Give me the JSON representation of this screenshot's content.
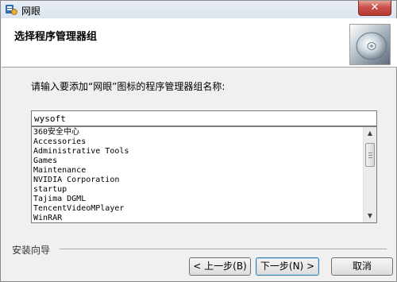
{
  "window": {
    "title": "网眼",
    "close_glyph": "✕"
  },
  "header": {
    "title": "选择程序管理器组",
    "image_icon": "cd-disc-icon"
  },
  "body": {
    "prompt": "请输入要添加“网眼”图标的程序管理器组名称:",
    "group_input_value": "wysoft",
    "groups": [
      "360安全中心",
      "Accessories",
      "Administrative Tools",
      "Games",
      "Maintenance",
      "NVIDIA Corporation",
      "startup",
      "Tajima DGML",
      "TencentVideoMPlayer",
      "WinRAR"
    ]
  },
  "footer": {
    "branding": "安装向导",
    "back_label": "< 上一步(B)",
    "next_label": "下一步(N) >",
    "cancel_label": "取消"
  }
}
